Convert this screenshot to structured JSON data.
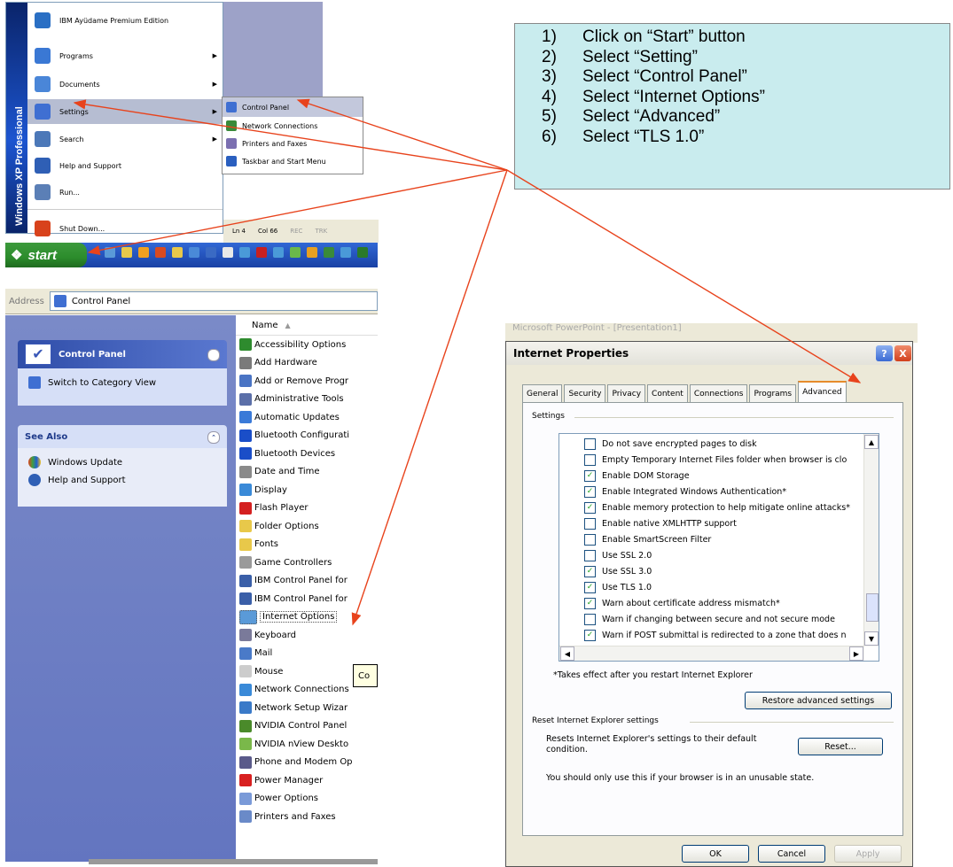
{
  "start_menu": {
    "strip_text": "Windows XP Professional",
    "items": [
      {
        "label": "IBM Ayüdame Premium Edition",
        "icon": "ibm-help-icon",
        "color": "#2a6fc4"
      },
      {
        "label": "Programs",
        "icon": "programs-icon",
        "color": "#3a78d4",
        "arrow": "▶"
      },
      {
        "label": "Documents",
        "icon": "documents-icon",
        "color": "#4a86d8",
        "arrow": "▶"
      },
      {
        "label": "Settings",
        "icon": "settings-icon",
        "color": "#3f6fd2",
        "arrow": "▶"
      },
      {
        "label": "Search",
        "icon": "search-icon",
        "color": "#4c78b8",
        "arrow": "▶"
      },
      {
        "label": "Help and Support",
        "icon": "help-icon",
        "color": "#2f5fb5"
      },
      {
        "label": "Run...",
        "icon": "run-icon",
        "color": "#5b7fb6"
      },
      {
        "label": "Shut Down...",
        "icon": "power-icon",
        "color": "#d8421c"
      }
    ],
    "submenu": [
      {
        "label": "Control Panel",
        "color": "#3f6fd2"
      },
      {
        "label": "Network Connections",
        "color": "#3a8a3a"
      },
      {
        "label": "Printers and Faxes",
        "color": "#7b6fb0"
      },
      {
        "label": "Taskbar and Start Menu",
        "color": "#2a5fbf"
      }
    ],
    "status": {
      "ln": "Ln 4",
      "col": "Col 66",
      "rec": "REC",
      "trk": "TRK"
    },
    "start_label": "start"
  },
  "address": {
    "label": "Address",
    "value": "Control Panel"
  },
  "cp_left": {
    "title": "Control Panel",
    "switch_link": "Switch to Category View",
    "see_also": "See Also",
    "links": [
      "Windows Update",
      "Help and Support"
    ]
  },
  "cp_list": {
    "header": "Name",
    "items": [
      {
        "label": "Accessibility Options",
        "color": "#2e8b2e"
      },
      {
        "label": "Add Hardware",
        "color": "#7a7a7a"
      },
      {
        "label": "Add or Remove Progr",
        "color": "#4a74c4"
      },
      {
        "label": "Administrative Tools",
        "color": "#5b6fa8"
      },
      {
        "label": "Automatic Updates",
        "color": "#3a7ad8"
      },
      {
        "label": "Bluetooth Configurati",
        "color": "#1a4ec8"
      },
      {
        "label": "Bluetooth Devices",
        "color": "#1a4ec8"
      },
      {
        "label": "Date and Time",
        "color": "#8a8a8a"
      },
      {
        "label": "Display",
        "color": "#3a8ad8"
      },
      {
        "label": "Flash Player",
        "color": "#d42020"
      },
      {
        "label": "Folder Options",
        "color": "#e8c84a"
      },
      {
        "label": "Fonts",
        "color": "#e8c84a"
      },
      {
        "label": "Game Controllers",
        "color": "#9a9a9a"
      },
      {
        "label": "IBM Control Panel for",
        "color": "#3a5fa8"
      },
      {
        "label": "IBM Control Panel for",
        "color": "#3a5fa8"
      },
      {
        "label": "Internet Options",
        "color": "#5a9ad8"
      },
      {
        "label": "Keyboard",
        "color": "#7a7a9a"
      },
      {
        "label": "Mail",
        "color": "#4a7ac8"
      },
      {
        "label": "Mouse",
        "color": "#cccccc"
      },
      {
        "label": "Network Connections",
        "color": "#3a8ad8"
      },
      {
        "label": "Network Setup Wizar",
        "color": "#3a7ac8"
      },
      {
        "label": "NVIDIA Control Panel",
        "color": "#4a8a2a"
      },
      {
        "label": "NVIDIA nView Deskto",
        "color": "#7ab84a"
      },
      {
        "label": "Phone and Modem Op",
        "color": "#5a5a8a"
      },
      {
        "label": "Power Manager",
        "color": "#d82020"
      },
      {
        "label": "Power Options",
        "color": "#7a9ad8"
      },
      {
        "label": "Printers and Faxes",
        "color": "#6a8ac8"
      }
    ],
    "tooltip": "Co"
  },
  "steps": [
    {
      "n": "1)",
      "text": "Click on “Start” button"
    },
    {
      "n": "2)",
      "text": "Select “Setting”"
    },
    {
      "n": "3)",
      "text": "Select “Control Panel”"
    },
    {
      "n": "4)",
      "text": "Select “Internet Options”"
    },
    {
      "n": "5)",
      "text": "Select “Advanced”"
    },
    {
      "n": "6)",
      "text": "Select “TLS 1.0”"
    }
  ],
  "dialog": {
    "behind_title": "Microsoft PowerPoint - [Presentation1]",
    "title": "Internet Properties",
    "help_btn": "?",
    "close_btn": "X",
    "tabs": [
      "General",
      "Security",
      "Privacy",
      "Content",
      "Connections",
      "Programs",
      "Advanced"
    ],
    "settings_label": "Settings",
    "options": [
      {
        "label": "Do not save encrypted pages to disk",
        "checked": false
      },
      {
        "label": "Empty Temporary Internet Files folder when browser is clo",
        "checked": false
      },
      {
        "label": "Enable DOM Storage",
        "checked": true
      },
      {
        "label": "Enable Integrated Windows Authentication*",
        "checked": true
      },
      {
        "label": "Enable memory protection to help mitigate online attacks*",
        "checked": true
      },
      {
        "label": "Enable native XMLHTTP support",
        "checked": false
      },
      {
        "label": "Enable SmartScreen Filter",
        "checked": false
      },
      {
        "label": "Use SSL 2.0",
        "checked": false
      },
      {
        "label": "Use SSL 3.0",
        "checked": true
      },
      {
        "label": "Use TLS 1.0",
        "checked": true
      },
      {
        "label": "Warn about certificate address mismatch*",
        "checked": true
      },
      {
        "label": "Warn if changing between secure and not secure mode",
        "checked": false
      },
      {
        "label": "Warn if POST submittal is redirected to a zone that does n",
        "checked": true
      }
    ],
    "note": "*Takes effect after you restart Internet Explorer",
    "restore_btn": "Restore advanced settings",
    "reset_group": "Reset Internet Explorer settings",
    "reset_text": "Resets Internet Explorer's settings to their default condition.",
    "reset_btn": "Reset...",
    "warn_text": "You should only use this if your browser is in an unusable state.",
    "ok": "OK",
    "cancel": "Cancel",
    "apply": "Apply"
  },
  "colors": {
    "arrow": "#e8431c",
    "instruction_bg": "#c9ecee",
    "xp_blue": "#1c55d0",
    "start_green": "#2c8c2c"
  }
}
